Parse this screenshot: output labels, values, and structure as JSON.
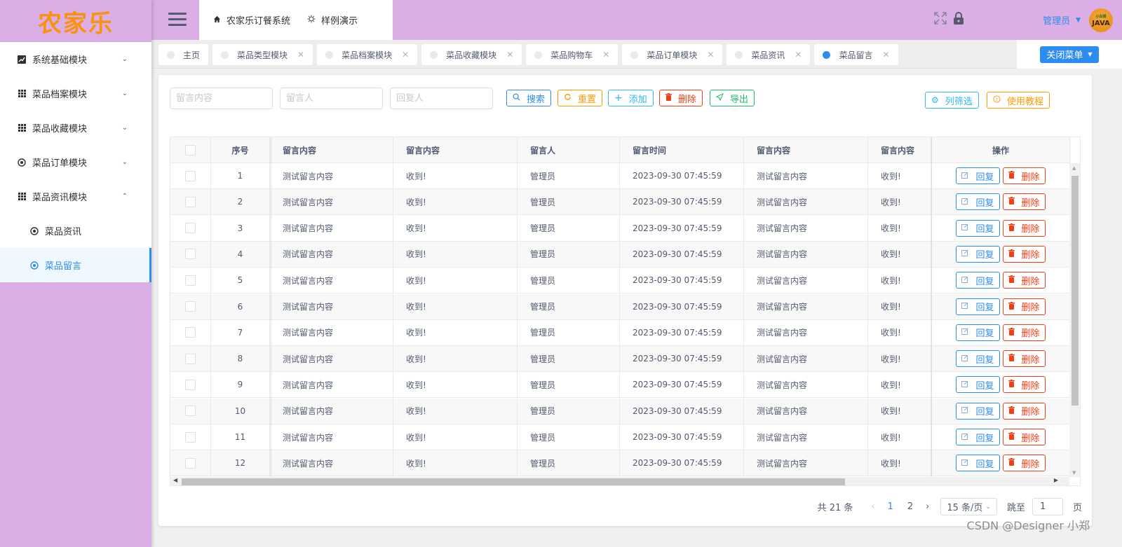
{
  "app": {
    "logo_text": "农家乐"
  },
  "header": {
    "nav": [
      {
        "label": "农家乐订餐系统",
        "icon": "home-icon"
      },
      {
        "label": "样例演示",
        "icon": "bulb-icon"
      }
    ],
    "user_name": "管理员",
    "avatar_text": "JAVA",
    "avatar_top": "小白鸽"
  },
  "sidebar": {
    "items": [
      {
        "label": "系统基础模块",
        "icon": "chart-icon",
        "expanded": false
      },
      {
        "label": "菜品档案模块",
        "icon": "grid-icon",
        "expanded": false
      },
      {
        "label": "菜品收藏模块",
        "icon": "grid-icon",
        "expanded": false
      },
      {
        "label": "菜品订单模块",
        "icon": "aperture-icon",
        "expanded": false
      },
      {
        "label": "菜品资讯模块",
        "icon": "grid-icon",
        "expanded": true
      }
    ],
    "sub_items": [
      {
        "label": "菜品资讯",
        "icon": "aperture-icon",
        "active": false
      },
      {
        "label": "菜品留言",
        "icon": "aperture-icon",
        "active": true
      }
    ]
  },
  "tabs": [
    {
      "label": "主页",
      "closable": false,
      "active": false
    },
    {
      "label": "菜品类型模块",
      "closable": true,
      "active": false
    },
    {
      "label": "菜品档案模块",
      "closable": true,
      "active": false
    },
    {
      "label": "菜品收藏模块",
      "closable": true,
      "active": false
    },
    {
      "label": "菜品购物车",
      "closable": true,
      "active": false
    },
    {
      "label": "菜品订单模块",
      "closable": true,
      "active": false
    },
    {
      "label": "菜品资讯",
      "closable": true,
      "active": false
    },
    {
      "label": "菜品留言",
      "closable": true,
      "active": true
    }
  ],
  "close_menu_label": "关闭菜单",
  "filters": {
    "content_placeholder": "留言内容",
    "user_placeholder": "留言人",
    "reply_user_placeholder": "回复人",
    "content_value": "",
    "user_value": "",
    "reply_user_value": ""
  },
  "toolbar": {
    "search": "搜索",
    "reset": "重置",
    "add": "添加",
    "delete": "删除",
    "export": "导出",
    "column_filter": "列筛选",
    "tutorial": "使用教程"
  },
  "table": {
    "columns": [
      "",
      "序号",
      "留言内容",
      "留言内容",
      "留言人",
      "留言时间",
      "留言内容",
      "留言内容",
      "操作"
    ],
    "rows": [
      {
        "no": "1",
        "content": "测试留言内容",
        "reply": "收到!",
        "user": "管理员",
        "time": "2023-09-30 07:45:59",
        "content2": "测试留言内容",
        "reply2": "收到!"
      },
      {
        "no": "2",
        "content": "测试留言内容",
        "reply": "收到!",
        "user": "管理员",
        "time": "2023-09-30 07:45:59",
        "content2": "测试留言内容",
        "reply2": "收到!"
      },
      {
        "no": "3",
        "content": "测试留言内容",
        "reply": "收到!",
        "user": "管理员",
        "time": "2023-09-30 07:45:59",
        "content2": "测试留言内容",
        "reply2": "收到!"
      },
      {
        "no": "4",
        "content": "测试留言内容",
        "reply": "收到!",
        "user": "管理员",
        "time": "2023-09-30 07:45:59",
        "content2": "测试留言内容",
        "reply2": "收到!"
      },
      {
        "no": "5",
        "content": "测试留言内容",
        "reply": "收到!",
        "user": "管理员",
        "time": "2023-09-30 07:45:59",
        "content2": "测试留言内容",
        "reply2": "收到!"
      },
      {
        "no": "6",
        "content": "测试留言内容",
        "reply": "收到!",
        "user": "管理员",
        "time": "2023-09-30 07:45:59",
        "content2": "测试留言内容",
        "reply2": "收到!"
      },
      {
        "no": "7",
        "content": "测试留言内容",
        "reply": "收到!",
        "user": "管理员",
        "time": "2023-09-30 07:45:59",
        "content2": "测试留言内容",
        "reply2": "收到!"
      },
      {
        "no": "8",
        "content": "测试留言内容",
        "reply": "收到!",
        "user": "管理员",
        "time": "2023-09-30 07:45:59",
        "content2": "测试留言内容",
        "reply2": "收到!"
      },
      {
        "no": "9",
        "content": "测试留言内容",
        "reply": "收到!",
        "user": "管理员",
        "time": "2023-09-30 07:45:59",
        "content2": "测试留言内容",
        "reply2": "收到!"
      },
      {
        "no": "10",
        "content": "测试留言内容",
        "reply": "收到!",
        "user": "管理员",
        "time": "2023-09-30 07:45:59",
        "content2": "测试留言内容",
        "reply2": "收到!"
      },
      {
        "no": "11",
        "content": "测试留言内容",
        "reply": "收到!",
        "user": "管理员",
        "time": "2023-09-30 07:45:59",
        "content2": "测试留言内容",
        "reply2": "收到!"
      },
      {
        "no": "12",
        "content": "测试留言内容",
        "reply": "收到!",
        "user": "管理员",
        "time": "2023-09-30 07:45:59",
        "content2": "测试留言内容",
        "reply2": "收到!"
      }
    ],
    "row_actions": {
      "reply": "回复",
      "delete": "删除"
    }
  },
  "pagination": {
    "total_text": "共 21 条",
    "pages": [
      "1",
      "2"
    ],
    "current_page": "1",
    "page_size": "15 条/页",
    "jump_label": "跳至",
    "jump_value": "1",
    "page_suffix": "页"
  },
  "watermark": "CSDN @Designer 小郑",
  "colors": {
    "primary": "#2d8cf0",
    "warning": "#ff9900",
    "info": "#2db7f5",
    "error": "#ed4014",
    "success": "#19be6b",
    "theme": "#dbaee5",
    "logo": "#f7930e"
  }
}
